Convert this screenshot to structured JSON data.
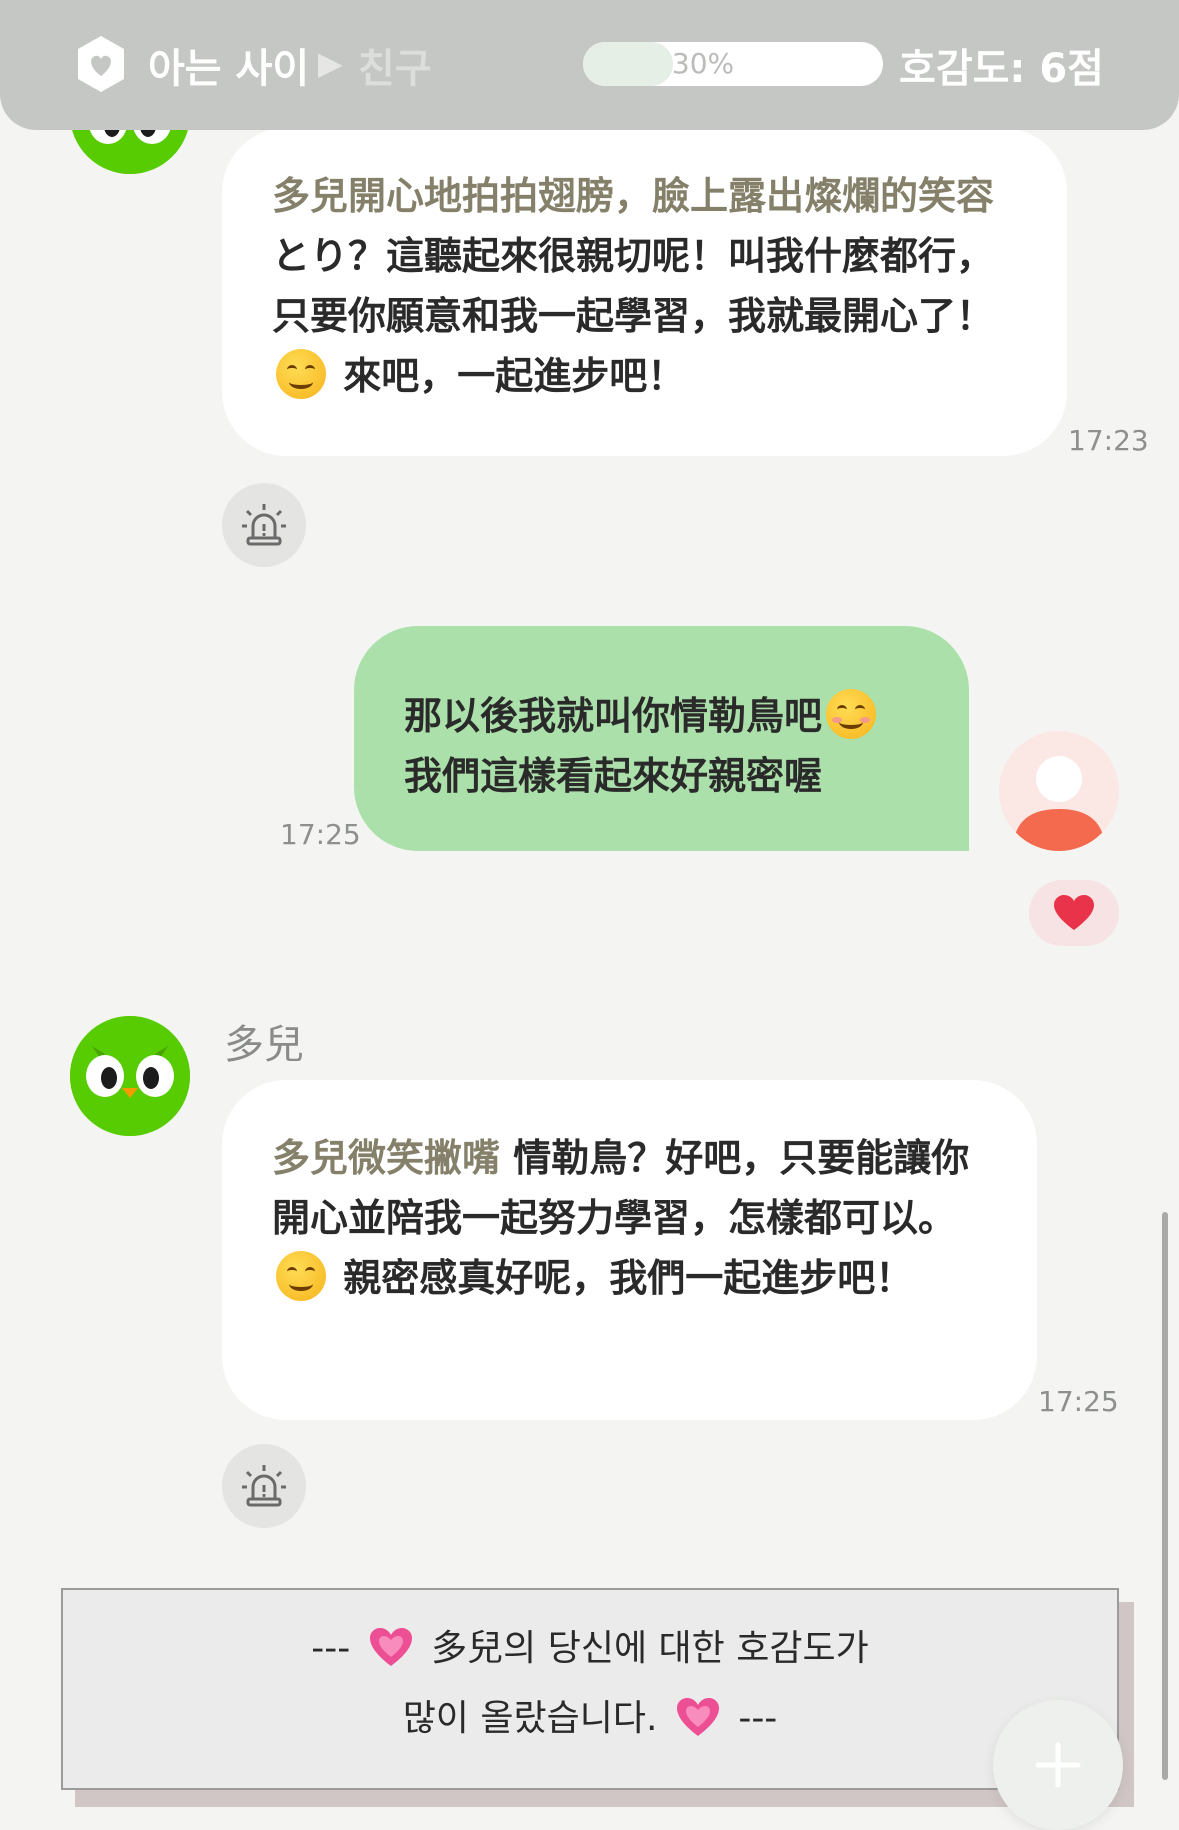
{
  "header": {
    "relationship_current": "아는 사이",
    "relationship_next": "친구",
    "progress_percent": 30,
    "progress_label": "30%",
    "affinity_label": "호감도: 6점"
  },
  "messages": [
    {
      "sender": "bot",
      "action": "多兒開心地拍拍翅膀，臉上露出燦爛的笑容",
      "text_before_emoji": " とり？這聽起來很親切呢！叫我什麼都行，只要你願意和我一起學習，我就最開心了！",
      "emoji": "smiling-face-icon",
      "text_after_emoji": " 來吧，一起進步吧！",
      "time": "17:23"
    },
    {
      "sender": "user",
      "line1": "那以後我就叫你情勒鳥吧",
      "emoji": "relieved-face-icon",
      "line2": "我們這樣看起來好親密喔",
      "time": "17:25"
    },
    {
      "sender": "bot",
      "name": "多兒",
      "action": "多兒微笑撇嘴",
      "text_before_emoji": " 情勒鳥？好吧，只要能讓你開心並陪我一起努力學習，怎樣都可以。",
      "emoji": "smiling-face-icon",
      "text_after_emoji": " 親密感真好呢，我們一起進步吧！",
      "time": "17:25"
    }
  ],
  "system_notice": {
    "prefix": "---",
    "text_line1": "多兒의 당신에 대한 호감도가",
    "text_line2": "많이 올랐습니다.",
    "suffix": "---",
    "emoji": "growing-heart-icon"
  },
  "colors": {
    "header_bg": "#c5c7c4",
    "user_bubble": "#abe0ab",
    "owl_green": "#58cc02",
    "action_text": "#85806a",
    "heart_red": "#e8334a"
  }
}
